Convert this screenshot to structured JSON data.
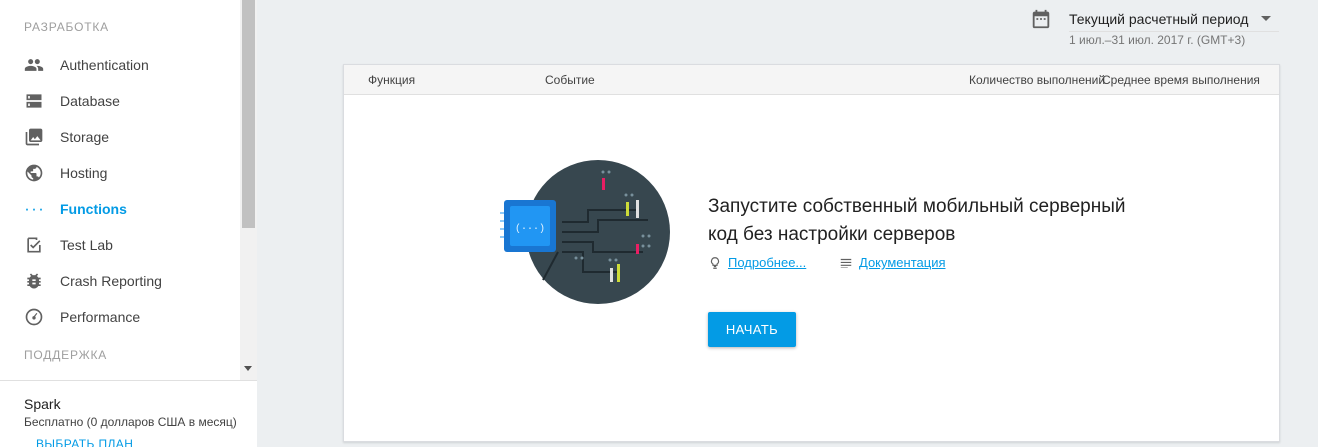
{
  "sidebar": {
    "section_dev": "РАЗРАБОТКА",
    "items": [
      {
        "label": "Authentication",
        "icon": "people-icon"
      },
      {
        "label": "Database",
        "icon": "database-icon"
      },
      {
        "label": "Storage",
        "icon": "image-icon"
      },
      {
        "label": "Hosting",
        "icon": "globe-icon"
      },
      {
        "label": "Functions",
        "icon": "functions-icon",
        "active": true
      },
      {
        "label": "Test Lab",
        "icon": "checklist-icon"
      },
      {
        "label": "Crash Reporting",
        "icon": "bug-icon"
      },
      {
        "label": "Performance",
        "icon": "speedometer-icon"
      }
    ],
    "section_support": "ПОДДЕРЖКА",
    "plan": {
      "name": "Spark",
      "description": "Бесплатно (0 долларов США в месяц)",
      "button": "ВЫБРАТЬ ПЛАН"
    }
  },
  "period": {
    "label": "Текущий расчетный период",
    "range": "1 июл.–31 июл. 2017 г. (GMT+3)"
  },
  "table": {
    "columns": [
      "Функция",
      "Событие",
      "Количество выполнений",
      "Среднее время выполнения"
    ]
  },
  "empty_state": {
    "title": "Запустите собственный мобильный серверный код без настройки серверов",
    "link_more": "Подробнее...",
    "link_docs": "Документация",
    "start_button": "НАЧАТЬ"
  },
  "colors": {
    "accent": "#039be5",
    "background": "#eceff1",
    "illustration_dark": "#37474f",
    "chip_blue": "#2196f3"
  }
}
